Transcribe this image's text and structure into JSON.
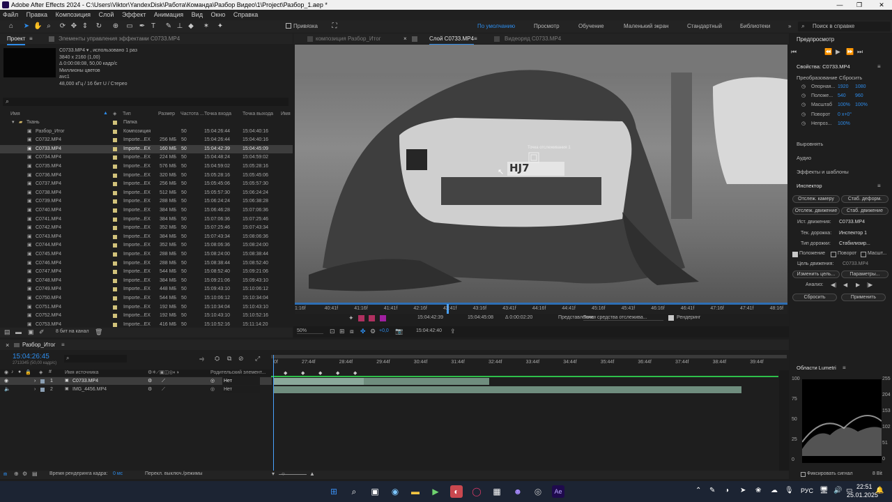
{
  "window": {
    "title": "Adobe After Effects 2024 - C:\\Users\\Viktor\\YandexDisk\\Работа\\Команда\\Разбор Видео\\1\\Project\\Разбор_1.aep *"
  },
  "menu": [
    "Файл",
    "Правка",
    "Композиция",
    "Слой",
    "Эффект",
    "Анимация",
    "Вид",
    "Окно",
    "Справка"
  ],
  "toolbar": {
    "snap_label": "Привязка",
    "workspaces": [
      "По умолчанию",
      "Просмотр",
      "Обучение",
      "Маленький экран",
      "Стандартный",
      "Библиотеки"
    ],
    "search_placeholder": "Поиск в справке"
  },
  "project": {
    "tabs": [
      "Проект",
      "Элементы управления эффектами C0733.MP4"
    ],
    "info": [
      "C0733.MP4 ▾ , использовано 1 раз",
      "3840 x 2160 (1,00)",
      "Δ 0:00:08:08, 50,00 кадр/с",
      "Миллионы цветов",
      "avc1",
      "48,000 кГц / 16 бит U / Стерео"
    ],
    "columns": [
      "Имя",
      "Тип",
      "Размер",
      "Частота ...",
      "Точка входа",
      "Точка выхода",
      "Имя"
    ],
    "items": [
      {
        "name": "Ткань",
        "type": "Папка",
        "size": "",
        "fps": "",
        "in": "",
        "out": ""
      },
      {
        "name": "Разбор_Итог",
        "type": "Композиция",
        "size": "",
        "fps": "50",
        "in": "15:04:26:44",
        "out": "15:04:40:16"
      },
      {
        "name": "C0732.MP4",
        "type": "Importe...EX",
        "size": "256 МБ",
        "fps": "50",
        "in": "15:04:26:44",
        "out": "15:04:40:16"
      },
      {
        "name": "C0733.MP4",
        "type": "Importe...EX",
        "size": "160 МБ",
        "fps": "50",
        "in": "15:04:42:39",
        "out": "15:04:45:09"
      },
      {
        "name": "C0734.MP4",
        "type": "Importe...EX",
        "size": "224 МБ",
        "fps": "50",
        "in": "15:04:48:24",
        "out": "15:04:59:02"
      },
      {
        "name": "C0735.MP4",
        "type": "Importe...EX",
        "size": "576 МБ",
        "fps": "50",
        "in": "15:04:59:02",
        "out": "15:05:28:16"
      },
      {
        "name": "C0736.MP4",
        "type": "Importe...EX",
        "size": "320 МБ",
        "fps": "50",
        "in": "15:05:28:16",
        "out": "15:05:45:06"
      },
      {
        "name": "C0737.MP4",
        "type": "Importe...EX",
        "size": "256 МБ",
        "fps": "50",
        "in": "15:05:45:06",
        "out": "15:05:57:30"
      },
      {
        "name": "C0738.MP4",
        "type": "Importe...EX",
        "size": "512 МБ",
        "fps": "50",
        "in": "15:05:57:30",
        "out": "15:06:24:24"
      },
      {
        "name": "C0739.MP4",
        "type": "Importe...EX",
        "size": "288 МБ",
        "fps": "50",
        "in": "15:06:24:24",
        "out": "15:06:38:28"
      },
      {
        "name": "C0740.MP4",
        "type": "Importe...EX",
        "size": "384 МБ",
        "fps": "50",
        "in": "15:06:46:28",
        "out": "15:07:06:36"
      },
      {
        "name": "C0741.MP4",
        "type": "Importe...EX",
        "size": "384 МБ",
        "fps": "50",
        "in": "15:07:06:36",
        "out": "15:07:25:46"
      },
      {
        "name": "C0742.MP4",
        "type": "Importe...EX",
        "size": "352 МБ",
        "fps": "50",
        "in": "15:07:25:46",
        "out": "15:07:43:34"
      },
      {
        "name": "C0743.MP4",
        "type": "Importe...EX",
        "size": "384 МБ",
        "fps": "50",
        "in": "15:07:43:34",
        "out": "15:08:06:36"
      },
      {
        "name": "C0744.MP4",
        "type": "Importe...EX",
        "size": "352 МБ",
        "fps": "50",
        "in": "15:08:06:36",
        "out": "15:08:24:00"
      },
      {
        "name": "C0745.MP4",
        "type": "Importe...EX",
        "size": "288 МБ",
        "fps": "50",
        "in": "15:08:24:00",
        "out": "15:08:38:44"
      },
      {
        "name": "C0746.MP4",
        "type": "Importe...EX",
        "size": "288 МБ",
        "fps": "50",
        "in": "15:08:38:44",
        "out": "15:08:52:40"
      },
      {
        "name": "C0747.MP4",
        "type": "Importe...EX",
        "size": "544 МБ",
        "fps": "50",
        "in": "15:08:52:40",
        "out": "15:09:21:06"
      },
      {
        "name": "C0748.MP4",
        "type": "Importe...EX",
        "size": "384 МБ",
        "fps": "50",
        "in": "15:09:21:06",
        "out": "15:09:43:10"
      },
      {
        "name": "C0749.MP4",
        "type": "Importe...EX",
        "size": "448 МБ",
        "fps": "50",
        "in": "15:09:43:10",
        "out": "15:10:06:12"
      },
      {
        "name": "C0750.MP4",
        "type": "Importe...EX",
        "size": "544 МБ",
        "fps": "50",
        "in": "15:10:06:12",
        "out": "15:10:34:04"
      },
      {
        "name": "C0751.MP4",
        "type": "Importe...EX",
        "size": "192 МБ",
        "fps": "50",
        "in": "15:10:34:04",
        "out": "15:10:43:10"
      },
      {
        "name": "C0752.MP4",
        "type": "Importe...EX",
        "size": "192 МБ",
        "fps": "50",
        "in": "15:10:43:10",
        "out": "15:10:52:16"
      },
      {
        "name": "C0753.MP4",
        "type": "Importe...EX",
        "size": "416 МБ",
        "fps": "50",
        "in": "15:10:52:16",
        "out": "15:11:14:20"
      }
    ],
    "bpc": "8 бит на канал"
  },
  "viewer": {
    "tabs": [
      "композиция Разбор_Итог",
      "Слой C0733.MP4",
      "Видеоряд C0733.MP4"
    ],
    "track_point_label": "Точка отслеживания 1",
    "plate": "HJ7",
    "ruler": [
      "1:16f",
      "40:41f",
      "41:16f",
      "41:41f",
      "42:16f",
      "42:41f",
      "43:16f",
      "43:41f",
      "44:16f",
      "44:41f",
      "45:16f",
      "45:41f",
      "46:16f",
      "46:41f",
      "47:16f",
      "47:41f",
      "48:16f"
    ],
    "in_time": "15:04:42:39",
    "out_time": "15:04:45:08",
    "duration": "Δ 0:00:02:20",
    "view_label": "Представление:",
    "view_value": "Точки средства отслежива...",
    "render_label": "Рендеринг",
    "zoom": "50%",
    "current_time": "15:04:42:40",
    "offset": "+0,0"
  },
  "timeline": {
    "tab": "Разбор_Итог",
    "timecode": "15:04:26:45",
    "frames": "2713345 (50,00 кадр/с)",
    "layer_columns": [
      "Имя источника",
      "Родительский элемент..."
    ],
    "layers": [
      {
        "num": "1",
        "name": "C0733.MP4",
        "parent": "Нет"
      },
      {
        "num": "2",
        "name": "IMG_4456.MP4",
        "parent": "Нет"
      }
    ],
    "ruler": [
      "0f",
      "27:44f",
      "28:44f",
      "29:44f",
      "30:44f",
      "31:44f",
      "32:44f",
      "33:44f",
      "34:44f",
      "35:44f",
      "36:44f",
      "37:44f",
      "38:44f",
      "39:44f"
    ],
    "render_time_label": "Время рендеринга кадра:",
    "render_time_value": "0 мс",
    "toggle_label": "Перекл. выключ./режимы"
  },
  "right": {
    "preview": "Предпросмотр",
    "properties_title": "Свойства: C0733.MP4",
    "transform_label": "Преобразование",
    "reset": "Сбросить",
    "props": [
      {
        "name": "Опорная...",
        "v1": "1920",
        "v2": "1080"
      },
      {
        "name": "Положе...",
        "v1": "540",
        "v2": "960"
      },
      {
        "name": "Масштаб",
        "v1": "100%",
        "v2": "100%"
      },
      {
        "name": "Поворот",
        "v1": "0 x+0°",
        "v2": ""
      },
      {
        "name": "Непроз...",
        "v1": "100%",
        "v2": ""
      }
    ],
    "sections": [
      "Выровнять",
      "Аудио",
      "Эффекты и шаблоны"
    ],
    "inspector": "Инспектор",
    "tracker_buttons": [
      "Отслеж. камеру",
      "Стаб. деформ.",
      "Отслеж. движение",
      "Стаб. движение"
    ],
    "motion_source_label": "Ист. движения:",
    "motion_source": "C0733.MP4",
    "current_track_label": "Тек. дорожка:",
    "current_track": "Инспектор 1",
    "track_type_label": "Тип дорожки:",
    "track_type": "Стабилизир...",
    "checks": [
      "Положение",
      "Поворот",
      "Масшт..."
    ],
    "motion_target_label": "Цель движения:",
    "motion_target": "C0733.MP4",
    "edit_target": "Изменить цель...",
    "options": "Параметры...",
    "analyze_label": "Анализ:",
    "reset_btn": "Сбросить",
    "apply_btn": "Применить",
    "lumetri": "Области Lumetri",
    "scope_left": [
      "100",
      "75",
      "50",
      "25",
      "0"
    ],
    "scope_right": [
      "255",
      "204",
      "153",
      "102",
      "51",
      "0"
    ],
    "clamp": "Фиксировать сигнал",
    "bit": "8 Bit"
  },
  "taskbar": {
    "lang": "РУС",
    "time": "22:51",
    "date": "25.01.2025"
  },
  "colors": {
    "accent": "#2d8ceb",
    "selection": "#3d3d3d",
    "taskbar": "#1c2433",
    "layer_bar": "#6f8d7e"
  }
}
